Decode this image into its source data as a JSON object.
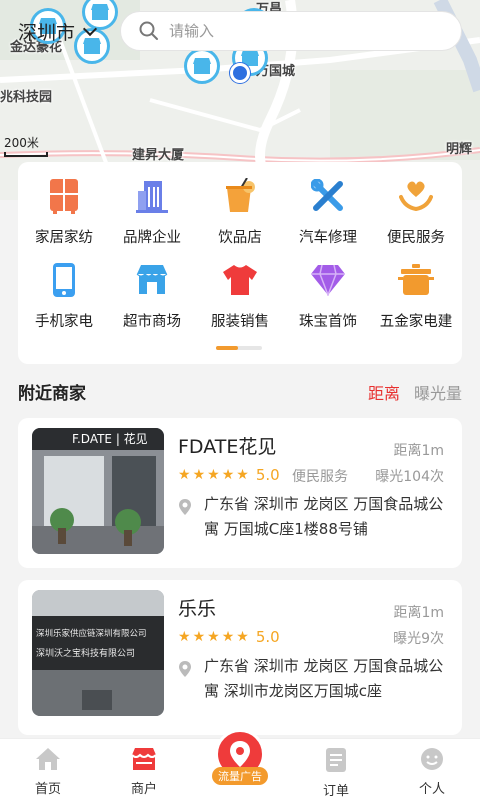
{
  "map": {
    "city": "深圳市",
    "search_placeholder": "请输入",
    "scale_label": "200米",
    "labels": {
      "jinda": "金达豪花",
      "tech_building": "兆科技园",
      "jiansheng": "建昇大厦",
      "wanguo": "万国城",
      "minghui": "明辉",
      "top": "万昌"
    }
  },
  "categories": [
    {
      "label": "家居家纺",
      "icon": "wardrobe-icon",
      "color": "#f2764a"
    },
    {
      "label": "品牌企业",
      "icon": "building-icon",
      "color": "#6a7fe8"
    },
    {
      "label": "饮品店",
      "icon": "drink-icon",
      "color": "#f4a23a"
    },
    {
      "label": "汽车修理",
      "icon": "wrench-icon",
      "color": "#3a9be8"
    },
    {
      "label": "便民服务",
      "icon": "heart-hand-icon",
      "color": "#f0a33a"
    },
    {
      "label": "手机家电",
      "icon": "phone-icon",
      "color": "#3b9ff0"
    },
    {
      "label": "超市商场",
      "icon": "store-icon",
      "color": "#3aa3e8"
    },
    {
      "label": "服装销售",
      "icon": "shirt-icon",
      "color": "#ef3b3b"
    },
    {
      "label": "珠宝首饰",
      "icon": "diamond-icon",
      "color": "#a35ce8"
    },
    {
      "label": "五金家电建",
      "icon": "pot-icon",
      "color": "#f29a2e"
    }
  ],
  "nearby": {
    "title": "附近商家",
    "sort_distance": "距离",
    "sort_exposure": "曝光量"
  },
  "merchants": [
    {
      "name": "FDATE花见",
      "distance": "距离1m",
      "score": "5.0",
      "category": "便民服务",
      "exposure": "曝光104次",
      "address": "广东省 深圳市 龙岗区 万国食品城公寓 万国城C座1楼88号铺",
      "sign": "F.DATE | 花见"
    },
    {
      "name": "乐乐",
      "distance": "距离1m",
      "score": "5.0",
      "category": "",
      "exposure": "曝光9次",
      "address": "广东省 深圳市 龙岗区 万国食品城公寓 深圳市龙岗区万国城c座",
      "sign_line1": "深圳乐家供应链深圳有限公司",
      "sign_line2": "深圳沃之宝科技有限公司"
    }
  ],
  "tabs": {
    "home": "首页",
    "merchant": "商户",
    "ads": "流量广告",
    "orders": "订单",
    "profile": "个人"
  },
  "colors": {
    "accent_red": "#e8302f",
    "star": "#f5a623",
    "pin_blue": "#49b6ea"
  }
}
